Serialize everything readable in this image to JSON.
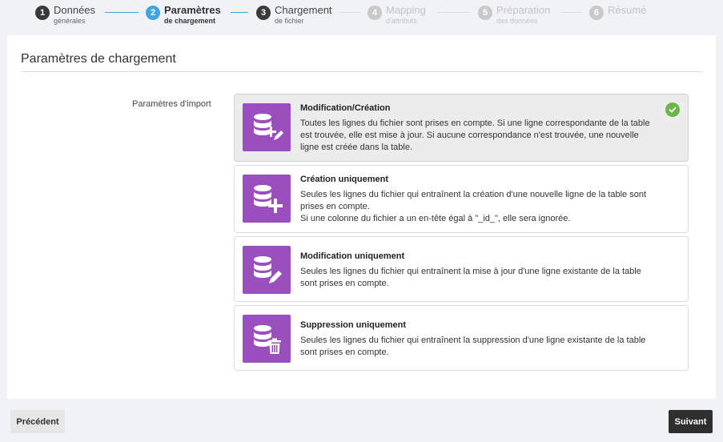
{
  "stepper": {
    "steps": [
      {
        "number": "1",
        "line1": "Données",
        "line2": "générales",
        "state": "done"
      },
      {
        "number": "2",
        "line1": "Paramètres",
        "line2": "de chargement",
        "state": "active"
      },
      {
        "number": "3",
        "line1": "Chargement",
        "line2": "de fichier",
        "state": "done"
      },
      {
        "number": "4",
        "line1": "Mapping",
        "line2": "d'attributs",
        "state": "todo"
      },
      {
        "number": "5",
        "line1": "Préparation",
        "line2": "des données",
        "state": "todo"
      },
      {
        "number": "6",
        "line1": "Résumé",
        "line2": "",
        "state": "todo"
      }
    ],
    "colors": {
      "active": "#3fa6e0",
      "done": "#3a3a3a",
      "todo": "#c9c9c9"
    }
  },
  "panel": {
    "title": "Paramètres de chargement",
    "field_label": "Paramètres d'import"
  },
  "options": [
    {
      "icon": "database-edit-plus-icon",
      "title": "Modification/Création",
      "description": "Toutes les lignes du fichier sont prises en compte. Si une ligne correspondante de la table est trouvée, elle est mise à jour. Si aucune correspondance n'est trouvée, une nouvelle ligne est créée dans la table.",
      "selected": true
    },
    {
      "icon": "database-plus-icon",
      "title": "Création uniquement",
      "description": "Seules les lignes du fichier qui entraînent la création d'une nouvelle ligne de la table sont prises en compte.",
      "description2": "Si une colonne du fichier a un en-tête égal à \"_id_\", elle sera ignorée.",
      "selected": false
    },
    {
      "icon": "database-edit-icon",
      "title": "Modification uniquement",
      "description": "Seules les lignes du fichier qui entraînent la mise à jour d'une ligne existante de la table sont prises en compte.",
      "selected": false
    },
    {
      "icon": "database-delete-icon",
      "title": "Suppression uniquement",
      "description": "Seules les lignes du fichier qui entraînent la suppression d'une ligne existante de la table sont prises en compte.",
      "selected": false
    }
  ],
  "footer": {
    "prev_label": "Précédent",
    "next_label": "Suivant"
  },
  "colors": {
    "accent_purple": "#9b4fbe",
    "check_green": "#6ab64a"
  }
}
